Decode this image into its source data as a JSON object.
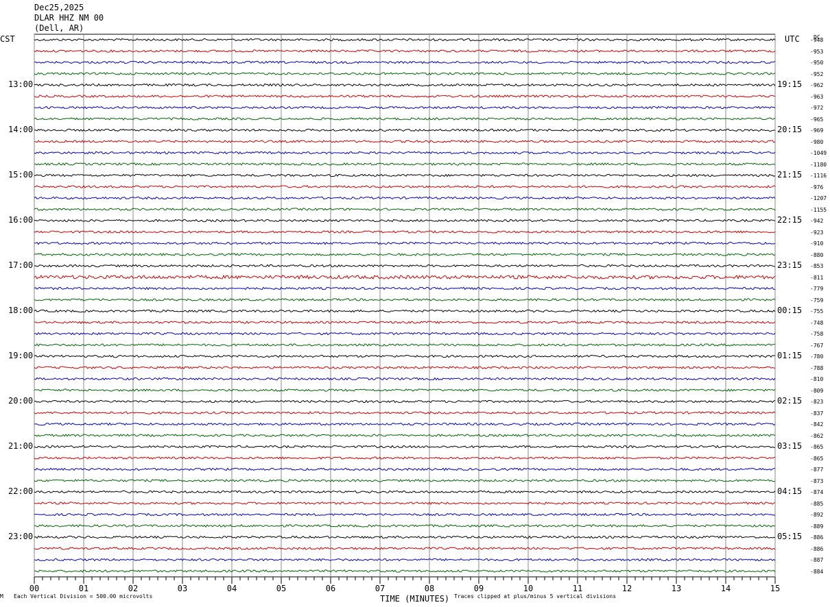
{
  "header": {
    "date": "Dec25,2025",
    "station": "DLAR HHZ NM 00",
    "location": "(Dell, AR)"
  },
  "left_timezone": "CST",
  "right_timezone": "UTC",
  "dc_label": "DC",
  "footer": {
    "scale_note": "Each Vertical Division =  500.00 microvolts",
    "clip_note": "Traces clipped at plus/minus 5 vertical divisions",
    "corner_mark": "M"
  },
  "trace_colors": [
    "#000000",
    "#cc0000",
    "#0000bb",
    "#006400"
  ],
  "chart_data": {
    "type": "line",
    "title": "",
    "xlabel": "TIME (MINUTES)",
    "ylabel": "",
    "xlim": [
      0,
      15
    ],
    "x_ticks": [
      "00",
      "01",
      "02",
      "03",
      "04",
      "05",
      "06",
      "07",
      "08",
      "09",
      "10",
      "11",
      "12",
      "13",
      "14",
      "15"
    ],
    "left_hour_labels": [
      "13:00",
      "14:00",
      "15:00",
      "16:00",
      "17:00",
      "18:00",
      "19:00",
      "20:00",
      "21:00",
      "22:00",
      "23:00"
    ],
    "right_hour_labels": [
      "19:15",
      "20:15",
      "21:15",
      "22:15",
      "23:15",
      "00:15",
      "01:15",
      "02:15",
      "03:15",
      "04:15",
      "05:15"
    ],
    "trace_dc_offsets": [
      "-948",
      "-953",
      "-950",
      "-952",
      "-962",
      "-963",
      "-972",
      "-965",
      "-969",
      "-980",
      "-1049",
      "-1180",
      "-1116",
      "-976",
      "-1207",
      "-1155",
      "-942",
      "-923",
      "-910",
      "-880",
      "-853",
      "-811",
      "-779",
      "-759",
      "-755",
      "-748",
      "-758",
      "-767",
      "-780",
      "-788",
      "-810",
      "-809",
      "-823",
      "-837",
      "-842",
      "-862",
      "-865",
      "-865",
      "-877",
      "-873",
      "-874",
      "-885",
      "-892",
      "-889",
      "-886",
      "-886",
      "-887",
      "-884"
    ],
    "traces_per_hour": 4,
    "grid": true
  }
}
